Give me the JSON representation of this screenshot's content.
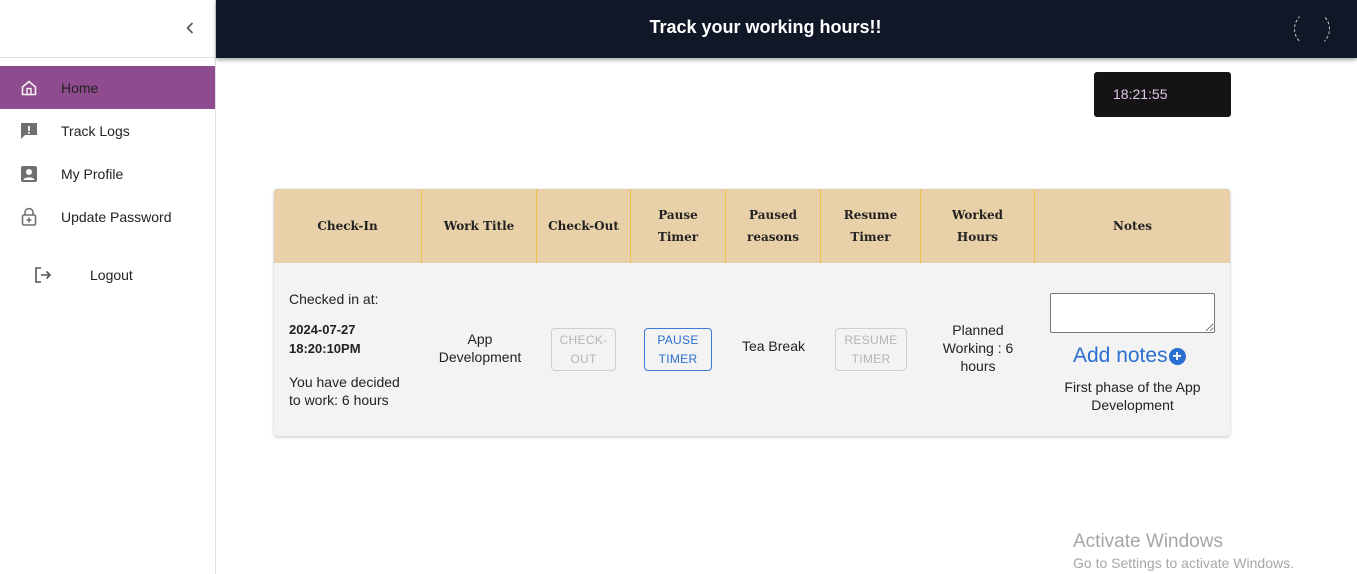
{
  "topbar": {
    "title": "Track your working hours!!"
  },
  "clock": {
    "time": "18:21:55"
  },
  "sidebar": {
    "items": [
      {
        "label": "Home",
        "icon": "home-icon",
        "active": true
      },
      {
        "label": "Track Logs",
        "icon": "feedback-icon",
        "active": false
      },
      {
        "label": "My Profile",
        "icon": "account-box-icon",
        "active": false
      },
      {
        "label": "Update Password",
        "icon": "lock-plus-icon",
        "active": false
      }
    ],
    "logout_label": "Logout"
  },
  "table": {
    "headers": {
      "check_in": "Check-In",
      "work_title": "Work Title",
      "check_out": "Check-Out",
      "pause_timer": "Pause Timer",
      "paused_reasons": "Paused reasons",
      "resume_timer": "Resume Timer",
      "worked_hours": "Worked Hours",
      "notes": "Notes"
    },
    "row": {
      "checked_in_label": "Checked in at:",
      "checked_in_date": "2024-07-27",
      "checked_in_time": "18:20:10PM",
      "decided_work": "You have decided to work: 6 hours",
      "work_title": "App Development",
      "check_out_button": "CHECK-OUT",
      "pause_button": "PAUSE TIMER",
      "paused_reason": "Tea Break",
      "resume_button": "RESUME TIMER",
      "worked_hours": "Planned Working : 6 hours",
      "notes_value": "",
      "add_notes_label": "Add notes",
      "note_text": "First phase of the App Development"
    }
  },
  "watermark": {
    "line1": "Activate Windows",
    "line2": "Go to Settings to activate Windows."
  },
  "colors": {
    "topbar_bg": "#101726",
    "active_nav": "#8e4b8e",
    "table_header": "#e8d0a8",
    "accent_blue": "#2a6fd0"
  }
}
